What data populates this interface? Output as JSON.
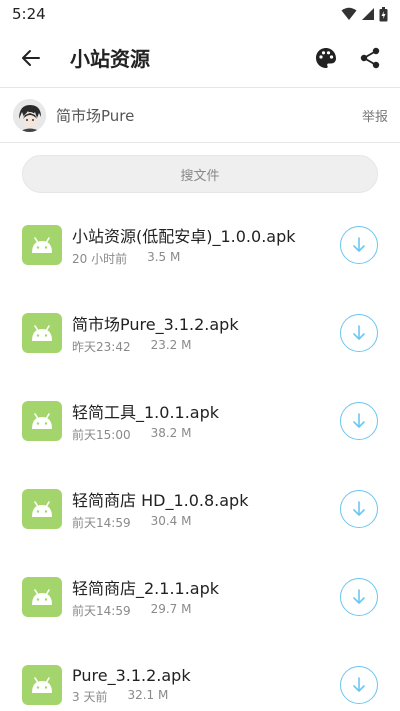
{
  "status_bar": {
    "time": "5:24"
  },
  "app_bar": {
    "title": "小站资源"
  },
  "publisher": {
    "name": "简市场Pure",
    "report_label": "举报"
  },
  "search": {
    "placeholder": "搜文件"
  },
  "files": [
    {
      "name": "小站资源(低配安卓)_1.0.0.apk",
      "time": "20 小时前",
      "size": "3.5 M"
    },
    {
      "name": "简市场Pure_3.1.2.apk",
      "time": "昨天23:42",
      "size": "23.2 M"
    },
    {
      "name": "轻简工具_1.0.1.apk",
      "time": "前天15:00",
      "size": "38.2 M"
    },
    {
      "name": "轻简商店 HD_1.0.8.apk",
      "time": "前天14:59",
      "size": "30.4 M"
    },
    {
      "name": "轻简商店_2.1.1.apk",
      "time": "前天14:59",
      "size": "29.7 M"
    },
    {
      "name": "Pure_3.1.2.apk",
      "time": "3 天前",
      "size": "32.1 M"
    }
  ],
  "icons": {
    "back": "arrow-left-icon",
    "palette": "palette-icon",
    "share": "share-icon",
    "file": "android-icon",
    "download": "download-icon"
  },
  "colors": {
    "accent": "#6cc7ef",
    "android_green": "#a4d56c"
  }
}
